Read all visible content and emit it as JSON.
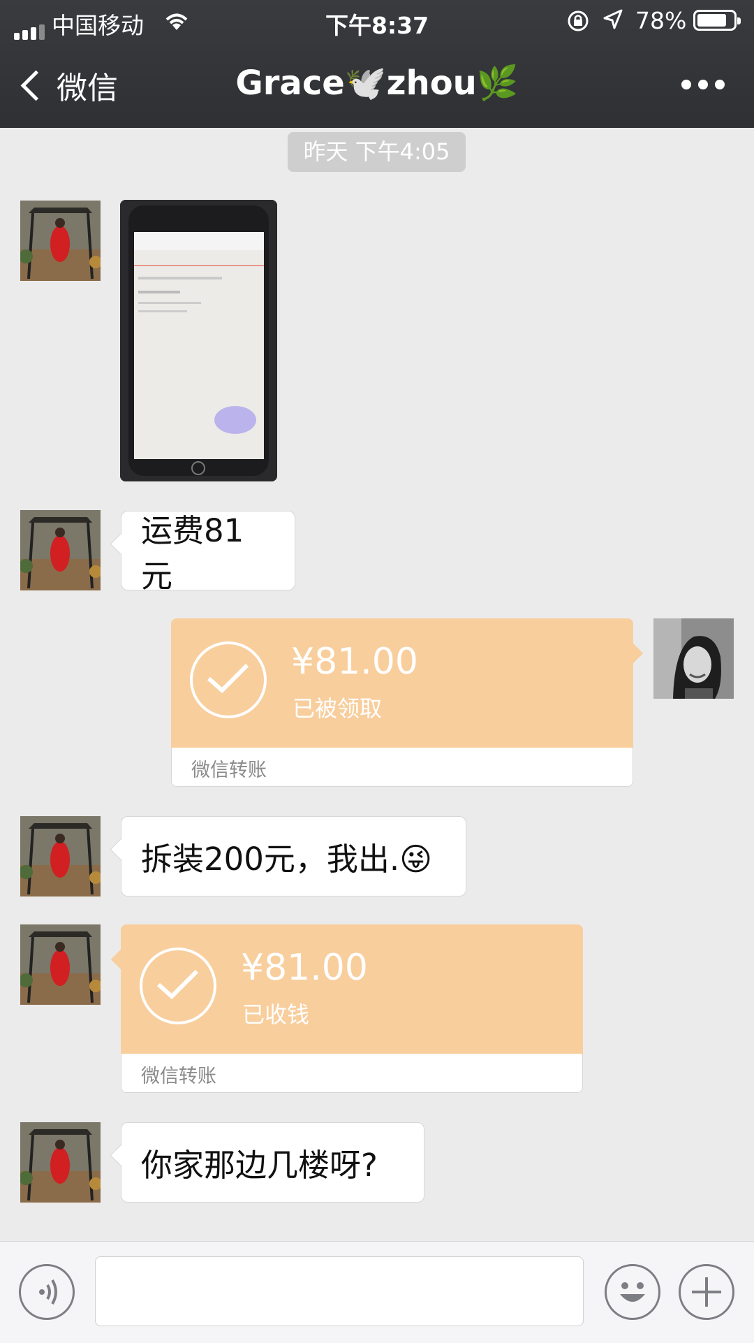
{
  "status_bar": {
    "carrier": "中国移动",
    "time": "下午8:37",
    "battery_percent": "78%",
    "battery_level": 0.78
  },
  "nav": {
    "back_label": "微信",
    "title": "Grace🕊️zhou🌿"
  },
  "chat": {
    "timestamp": "昨天 下午4:05",
    "messages": [
      {
        "sender": "contact",
        "type": "image"
      },
      {
        "sender": "contact",
        "type": "text",
        "text": "运费81元"
      },
      {
        "sender": "me",
        "type": "transfer",
        "amount": "¥81.00",
        "status": "已被领取",
        "footer": "微信转账"
      },
      {
        "sender": "contact",
        "type": "text",
        "text": "拆装200元，我出.😜"
      },
      {
        "sender": "contact",
        "type": "transfer",
        "amount": "¥81.00",
        "status": "已收钱",
        "footer": "微信转账"
      },
      {
        "sender": "contact",
        "type": "text",
        "text": "你家那边几楼呀?"
      }
    ]
  },
  "colors": {
    "header_bg": "#35363a",
    "chat_bg": "#ebebeb",
    "transfer_orange": "#f8ce9d"
  },
  "icons": [
    "signal-icon",
    "wifi-icon",
    "orientation-lock-icon",
    "location-arrow-icon",
    "battery-icon",
    "back-chevron-icon",
    "more-dots-icon",
    "check-circle-icon",
    "voice-icon",
    "emoji-icon",
    "plus-icon"
  ]
}
